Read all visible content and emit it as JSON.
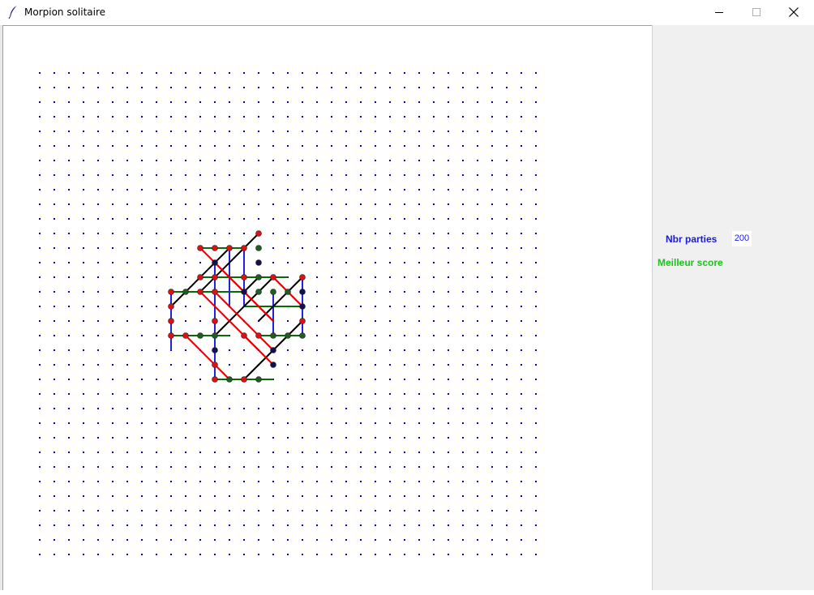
{
  "window": {
    "title": "Morpion solitaire",
    "icon": "feather-icon",
    "controls": [
      "minimize-icon",
      "maximize-icon",
      "close-icon"
    ]
  },
  "panel": {
    "nbr_parties_label": "Nbr parties",
    "nbr_parties_value": "200",
    "best_score_label": "Meilleur score"
  },
  "colors": {
    "grid_dot": "#0000cc",
    "nbr_label": "#1a1adc",
    "best_label": "#1fc01f",
    "line_red": "#e00000",
    "line_green": "#0a6a0a",
    "line_blue": "#2222dd",
    "line_black": "#000000",
    "point_red": "#e01010",
    "point_green": "#1e5e1e",
    "point_navy": "#101055"
  },
  "board": {
    "columns": 35,
    "rows": 34,
    "lines": [
      {
        "color": "green",
        "from": [
          11,
          12
        ],
        "to": [
          14,
          12
        ]
      },
      {
        "color": "green",
        "from": [
          9,
          15
        ],
        "to": [
          14,
          15
        ]
      },
      {
        "color": "green",
        "from": [
          11,
          14
        ],
        "to": [
          17,
          14
        ]
      },
      {
        "color": "green",
        "from": [
          14,
          16
        ],
        "to": [
          18,
          16
        ]
      },
      {
        "color": "green",
        "from": [
          9,
          18
        ],
        "to": [
          13,
          18
        ]
      },
      {
        "color": "green",
        "from": [
          15,
          18
        ],
        "to": [
          18,
          18
        ]
      },
      {
        "color": "green",
        "from": [
          12,
          21
        ],
        "to": [
          16,
          21
        ]
      },
      {
        "color": "blue",
        "from": [
          12,
          13
        ],
        "to": [
          12,
          17
        ]
      },
      {
        "color": "blue",
        "from": [
          13,
          12
        ],
        "to": [
          13,
          16
        ]
      },
      {
        "color": "blue",
        "from": [
          14,
          12
        ],
        "to": [
          14,
          16
        ]
      },
      {
        "color": "blue",
        "from": [
          16,
          15
        ],
        "to": [
          16,
          18
        ]
      },
      {
        "color": "blue",
        "from": [
          18,
          14
        ],
        "to": [
          18,
          18
        ]
      },
      {
        "color": "blue",
        "from": [
          9,
          15
        ],
        "to": [
          9,
          19
        ]
      },
      {
        "color": "blue",
        "from": [
          12,
          17
        ],
        "to": [
          12,
          21
        ]
      },
      {
        "color": "black",
        "from": [
          11,
          15
        ],
        "to": [
          15,
          11
        ]
      },
      {
        "color": "black",
        "from": [
          9,
          16
        ],
        "to": [
          13,
          12
        ]
      },
      {
        "color": "black",
        "from": [
          14,
          15
        ],
        "to": [
          15,
          14
        ]
      },
      {
        "color": "black",
        "from": [
          15,
          17
        ],
        "to": [
          18,
          14
        ]
      },
      {
        "color": "black",
        "from": [
          12,
          18
        ],
        "to": [
          16,
          14
        ]
      },
      {
        "color": "black",
        "from": [
          14,
          21
        ],
        "to": [
          18,
          17
        ]
      },
      {
        "color": "red",
        "from": [
          11,
          12
        ],
        "to": [
          16,
          17
        ]
      },
      {
        "color": "red",
        "from": [
          12,
          13
        ],
        "to": [
          16,
          17
        ]
      },
      {
        "color": "red",
        "from": [
          16,
          14
        ],
        "to": [
          18,
          16
        ]
      },
      {
        "color": "red",
        "from": [
          11,
          15
        ],
        "to": [
          16,
          20
        ]
      },
      {
        "color": "red",
        "from": [
          12,
          15
        ],
        "to": [
          16,
          19
        ]
      },
      {
        "color": "red",
        "from": [
          10,
          18
        ],
        "to": [
          13,
          21
        ]
      },
      {
        "color": "red",
        "from": [
          14,
          18
        ],
        "to": [
          15,
          19
        ]
      }
    ],
    "points": [
      {
        "c": [
          15,
          11
        ],
        "color": "red"
      },
      {
        "c": [
          11,
          12
        ],
        "color": "red"
      },
      {
        "c": [
          12,
          12
        ],
        "color": "red"
      },
      {
        "c": [
          13,
          12
        ],
        "color": "red"
      },
      {
        "c": [
          14,
          12
        ],
        "color": "red"
      },
      {
        "c": [
          15,
          12
        ],
        "color": "green"
      },
      {
        "c": [
          12,
          13
        ],
        "color": "navy"
      },
      {
        "c": [
          15,
          13
        ],
        "color": "navy"
      },
      {
        "c": [
          11,
          14
        ],
        "color": "red"
      },
      {
        "c": [
          12,
          14
        ],
        "color": "red"
      },
      {
        "c": [
          14,
          14
        ],
        "color": "red"
      },
      {
        "c": [
          15,
          14
        ],
        "color": "green"
      },
      {
        "c": [
          16,
          14
        ],
        "color": "red"
      },
      {
        "c": [
          18,
          14
        ],
        "color": "red"
      },
      {
        "c": [
          9,
          15
        ],
        "color": "red"
      },
      {
        "c": [
          10,
          15
        ],
        "color": "green"
      },
      {
        "c": [
          11,
          15
        ],
        "color": "red"
      },
      {
        "c": [
          12,
          15
        ],
        "color": "red"
      },
      {
        "c": [
          14,
          15
        ],
        "color": "navy"
      },
      {
        "c": [
          15,
          15
        ],
        "color": "green"
      },
      {
        "c": [
          16,
          15
        ],
        "color": "green"
      },
      {
        "c": [
          17,
          15
        ],
        "color": "green"
      },
      {
        "c": [
          18,
          15
        ],
        "color": "navy"
      },
      {
        "c": [
          9,
          16
        ],
        "color": "red"
      },
      {
        "c": [
          18,
          16
        ],
        "color": "navy"
      },
      {
        "c": [
          9,
          17
        ],
        "color": "red"
      },
      {
        "c": [
          12,
          17
        ],
        "color": "red"
      },
      {
        "c": [
          18,
          17
        ],
        "color": "red"
      },
      {
        "c": [
          9,
          18
        ],
        "color": "red"
      },
      {
        "c": [
          10,
          18
        ],
        "color": "red"
      },
      {
        "c": [
          11,
          18
        ],
        "color": "green"
      },
      {
        "c": [
          12,
          18
        ],
        "color": "green"
      },
      {
        "c": [
          14,
          18
        ],
        "color": "red"
      },
      {
        "c": [
          15,
          18
        ],
        "color": "red"
      },
      {
        "c": [
          16,
          18
        ],
        "color": "green"
      },
      {
        "c": [
          17,
          18
        ],
        "color": "green"
      },
      {
        "c": [
          18,
          18
        ],
        "color": "green"
      },
      {
        "c": [
          12,
          19
        ],
        "color": "navy"
      },
      {
        "c": [
          16,
          19
        ],
        "color": "navy"
      },
      {
        "c": [
          12,
          20
        ],
        "color": "red"
      },
      {
        "c": [
          16,
          20
        ],
        "color": "navy"
      },
      {
        "c": [
          12,
          21
        ],
        "color": "red"
      },
      {
        "c": [
          13,
          21
        ],
        "color": "green"
      },
      {
        "c": [
          14,
          21
        ],
        "color": "red"
      },
      {
        "c": [
          15,
          21
        ],
        "color": "green"
      }
    ]
  }
}
